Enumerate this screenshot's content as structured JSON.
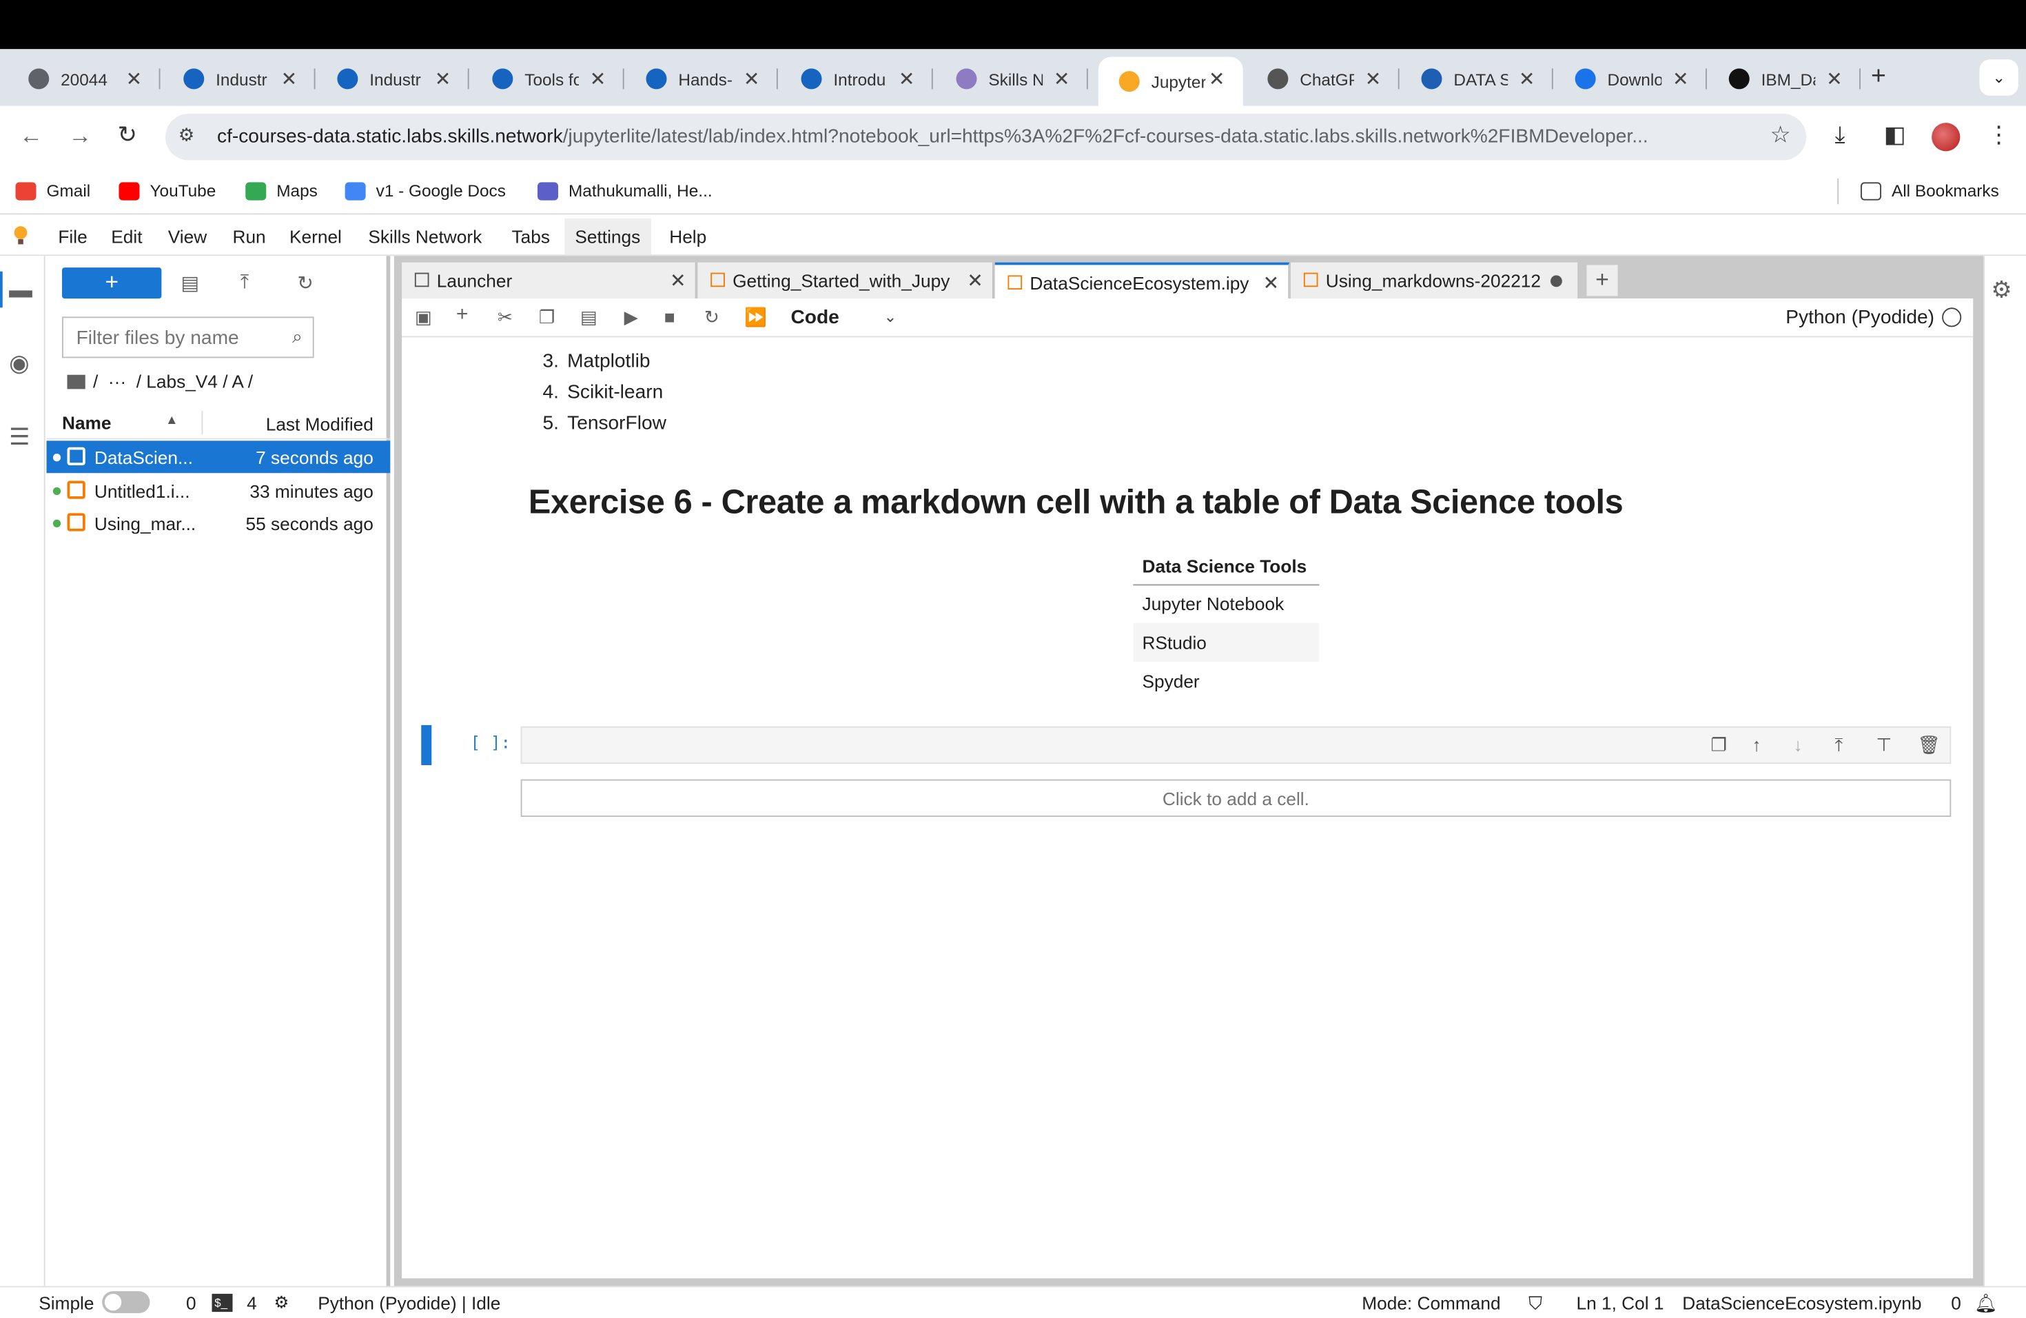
{
  "browser": {
    "tabs": [
      {
        "title": "20044",
        "icon": "globe-icon",
        "color": "#5f6368"
      },
      {
        "title": "Industr",
        "icon": "coursera-icon",
        "color": "#1565c0"
      },
      {
        "title": "Industr",
        "icon": "coursera-icon",
        "color": "#1565c0"
      },
      {
        "title": "Tools fo",
        "icon": "coursera-icon",
        "color": "#1565c0"
      },
      {
        "title": "Hands-",
        "icon": "coursera-icon",
        "color": "#1565c0"
      },
      {
        "title": "Introdu",
        "icon": "coursera-icon",
        "color": "#1565c0"
      },
      {
        "title": "Skills N",
        "icon": "skills-network-icon",
        "color": "#8e7cc3"
      },
      {
        "title": "Jupyter",
        "icon": "jupyterlite-icon",
        "color": "#f9a825"
      },
      {
        "title": "ChatGP",
        "icon": "chatgpt-icon",
        "color": "#555555"
      },
      {
        "title": "DATA S",
        "icon": "word-icon",
        "color": "#1e5fb4"
      },
      {
        "title": "Downlo",
        "icon": "download-icon",
        "color": "#1a73e8"
      },
      {
        "title": "IBM_Da",
        "icon": "github-icon",
        "color": "#111111"
      }
    ],
    "active_tab_index": 7,
    "url_host": "cf-courses-data.static.labs.skills.network",
    "url_path": "/jupyterlite/latest/lab/index.html?notebook_url=https%3A%2F%2Fcf-courses-data.static.labs.skills.network%2FIBMDeveloper...",
    "bookmarks": [
      {
        "label": "Gmail",
        "color": "#ea4335"
      },
      {
        "label": "YouTube",
        "color": "#ff0000"
      },
      {
        "label": "Maps",
        "color": "#34a853"
      },
      {
        "label": "v1 - Google Docs",
        "color": "#4285f4"
      },
      {
        "label": "Mathukumalli, He...",
        "color": "#5b5fc7"
      }
    ],
    "all_bookmarks": "All Bookmarks"
  },
  "jupyter": {
    "menu": [
      "File",
      "Edit",
      "View",
      "Run",
      "Kernel",
      "Skills Network",
      "Tabs",
      "Settings",
      "Help"
    ],
    "active_menu": "Settings",
    "filebrowser": {
      "filter_placeholder": "Filter files by name",
      "breadcrumb": "/  ···  / Labs_V4 / A /",
      "col_name": "Name",
      "col_modified": "Last Modified",
      "files": [
        {
          "name": "DataScien...",
          "modified": "7 seconds ago",
          "selected": true
        },
        {
          "name": "Untitled1.i...",
          "modified": "33 minutes ago",
          "selected": false
        },
        {
          "name": "Using_mar...",
          "modified": "55 seconds ago",
          "selected": false
        }
      ]
    },
    "doc_tabs": [
      {
        "label": "Launcher",
        "kind": "launcher",
        "close": "x"
      },
      {
        "label": "Getting_Started_with_Jupy",
        "kind": "notebook",
        "close": "x"
      },
      {
        "label": "DataScienceEcosystem.ipy",
        "kind": "notebook",
        "close": "x",
        "active": true
      },
      {
        "label": "Using_markdowns-202212",
        "kind": "notebook",
        "close": "dot"
      }
    ],
    "toolbar": {
      "cell_type": "Code",
      "kernel": "Python (Pyodide)"
    },
    "notebook": {
      "list_items": [
        {
          "num": "3.",
          "text": "Matplotlib"
        },
        {
          "num": "4.",
          "text": "Scikit-learn"
        },
        {
          "num": "5.",
          "text": "TensorFlow"
        }
      ],
      "heading": "Exercise 6 - Create a markdown cell with a table of Data Science tools",
      "table_header": "Data Science Tools",
      "table_rows": [
        "Jupyter Notebook",
        "RStudio",
        "Spyder"
      ],
      "prompt": "[ ]:",
      "add_cell": "Click to add a cell."
    },
    "status": {
      "mode_label": "Simple",
      "terminals": "0",
      "kernels": "4",
      "kernel_status": "Python (Pyodide) | Idle",
      "mode": "Mode: Command",
      "cursor": "Ln 1, Col 1",
      "filename": "DataScienceEcosystem.ipynb",
      "notifications": "0"
    }
  }
}
